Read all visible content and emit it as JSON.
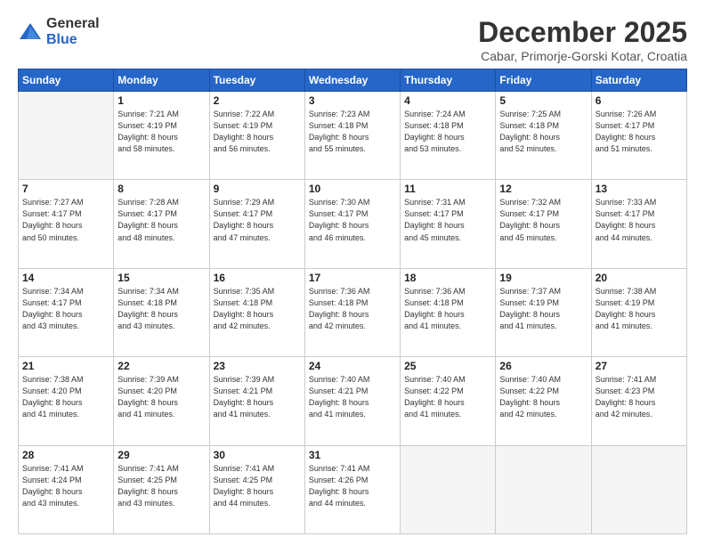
{
  "header": {
    "logo_general": "General",
    "logo_blue": "Blue",
    "month_title": "December 2025",
    "location": "Cabar, Primorje-Gorski Kotar, Croatia"
  },
  "weekdays": [
    "Sunday",
    "Monday",
    "Tuesday",
    "Wednesday",
    "Thursday",
    "Friday",
    "Saturday"
  ],
  "weeks": [
    [
      {
        "day": "",
        "info": ""
      },
      {
        "day": "1",
        "info": "Sunrise: 7:21 AM\nSunset: 4:19 PM\nDaylight: 8 hours\nand 58 minutes."
      },
      {
        "day": "2",
        "info": "Sunrise: 7:22 AM\nSunset: 4:19 PM\nDaylight: 8 hours\nand 56 minutes."
      },
      {
        "day": "3",
        "info": "Sunrise: 7:23 AM\nSunset: 4:18 PM\nDaylight: 8 hours\nand 55 minutes."
      },
      {
        "day": "4",
        "info": "Sunrise: 7:24 AM\nSunset: 4:18 PM\nDaylight: 8 hours\nand 53 minutes."
      },
      {
        "day": "5",
        "info": "Sunrise: 7:25 AM\nSunset: 4:18 PM\nDaylight: 8 hours\nand 52 minutes."
      },
      {
        "day": "6",
        "info": "Sunrise: 7:26 AM\nSunset: 4:17 PM\nDaylight: 8 hours\nand 51 minutes."
      }
    ],
    [
      {
        "day": "7",
        "info": "Sunrise: 7:27 AM\nSunset: 4:17 PM\nDaylight: 8 hours\nand 50 minutes."
      },
      {
        "day": "8",
        "info": "Sunrise: 7:28 AM\nSunset: 4:17 PM\nDaylight: 8 hours\nand 48 minutes."
      },
      {
        "day": "9",
        "info": "Sunrise: 7:29 AM\nSunset: 4:17 PM\nDaylight: 8 hours\nand 47 minutes."
      },
      {
        "day": "10",
        "info": "Sunrise: 7:30 AM\nSunset: 4:17 PM\nDaylight: 8 hours\nand 46 minutes."
      },
      {
        "day": "11",
        "info": "Sunrise: 7:31 AM\nSunset: 4:17 PM\nDaylight: 8 hours\nand 45 minutes."
      },
      {
        "day": "12",
        "info": "Sunrise: 7:32 AM\nSunset: 4:17 PM\nDaylight: 8 hours\nand 45 minutes."
      },
      {
        "day": "13",
        "info": "Sunrise: 7:33 AM\nSunset: 4:17 PM\nDaylight: 8 hours\nand 44 minutes."
      }
    ],
    [
      {
        "day": "14",
        "info": "Sunrise: 7:34 AM\nSunset: 4:17 PM\nDaylight: 8 hours\nand 43 minutes."
      },
      {
        "day": "15",
        "info": "Sunrise: 7:34 AM\nSunset: 4:18 PM\nDaylight: 8 hours\nand 43 minutes."
      },
      {
        "day": "16",
        "info": "Sunrise: 7:35 AM\nSunset: 4:18 PM\nDaylight: 8 hours\nand 42 minutes."
      },
      {
        "day": "17",
        "info": "Sunrise: 7:36 AM\nSunset: 4:18 PM\nDaylight: 8 hours\nand 42 minutes."
      },
      {
        "day": "18",
        "info": "Sunrise: 7:36 AM\nSunset: 4:18 PM\nDaylight: 8 hours\nand 41 minutes."
      },
      {
        "day": "19",
        "info": "Sunrise: 7:37 AM\nSunset: 4:19 PM\nDaylight: 8 hours\nand 41 minutes."
      },
      {
        "day": "20",
        "info": "Sunrise: 7:38 AM\nSunset: 4:19 PM\nDaylight: 8 hours\nand 41 minutes."
      }
    ],
    [
      {
        "day": "21",
        "info": "Sunrise: 7:38 AM\nSunset: 4:20 PM\nDaylight: 8 hours\nand 41 minutes."
      },
      {
        "day": "22",
        "info": "Sunrise: 7:39 AM\nSunset: 4:20 PM\nDaylight: 8 hours\nand 41 minutes."
      },
      {
        "day": "23",
        "info": "Sunrise: 7:39 AM\nSunset: 4:21 PM\nDaylight: 8 hours\nand 41 minutes."
      },
      {
        "day": "24",
        "info": "Sunrise: 7:40 AM\nSunset: 4:21 PM\nDaylight: 8 hours\nand 41 minutes."
      },
      {
        "day": "25",
        "info": "Sunrise: 7:40 AM\nSunset: 4:22 PM\nDaylight: 8 hours\nand 41 minutes."
      },
      {
        "day": "26",
        "info": "Sunrise: 7:40 AM\nSunset: 4:22 PM\nDaylight: 8 hours\nand 42 minutes."
      },
      {
        "day": "27",
        "info": "Sunrise: 7:41 AM\nSunset: 4:23 PM\nDaylight: 8 hours\nand 42 minutes."
      }
    ],
    [
      {
        "day": "28",
        "info": "Sunrise: 7:41 AM\nSunset: 4:24 PM\nDaylight: 8 hours\nand 43 minutes."
      },
      {
        "day": "29",
        "info": "Sunrise: 7:41 AM\nSunset: 4:25 PM\nDaylight: 8 hours\nand 43 minutes."
      },
      {
        "day": "30",
        "info": "Sunrise: 7:41 AM\nSunset: 4:25 PM\nDaylight: 8 hours\nand 44 minutes."
      },
      {
        "day": "31",
        "info": "Sunrise: 7:41 AM\nSunset: 4:26 PM\nDaylight: 8 hours\nand 44 minutes."
      },
      {
        "day": "",
        "info": ""
      },
      {
        "day": "",
        "info": ""
      },
      {
        "day": "",
        "info": ""
      }
    ]
  ]
}
